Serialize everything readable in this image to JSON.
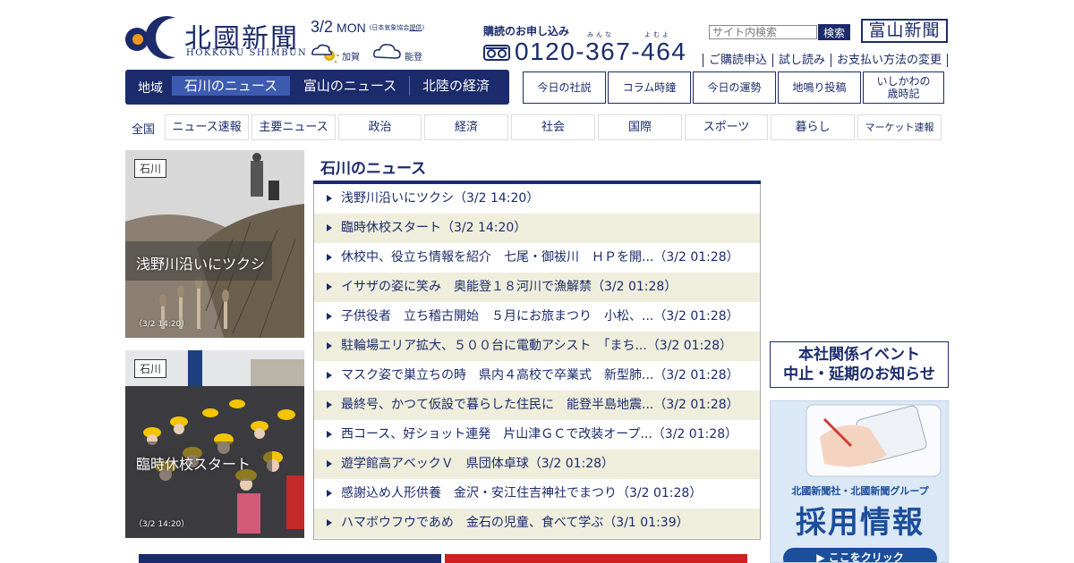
{
  "header": {
    "logo_ja": "北國新聞",
    "logo_en": "HOKKOKU SHIMBUN",
    "date": "3/2",
    "weekday": "MON",
    "weather_source_prefix": "(日本気象協会",
    "weather_source_link": "提供",
    "weather_source_suffix": ")",
    "weather": [
      {
        "area": "加賀",
        "icon": "sun-cloud-icon"
      },
      {
        "area": "能登",
        "icon": "cloud-icon"
      }
    ],
    "subscribe_title": "購読のお申し込み",
    "phone_ruby_1": "みんな",
    "phone_ruby_2": "よむよ",
    "phone": "0120-367-464",
    "search_placeholder": "サイト内検索",
    "search_button": "検索",
    "toyama_logo": "富山新聞",
    "sublinks": [
      "ご購読申込",
      "試し読み",
      "お支払い方法の変更"
    ]
  },
  "region_nav": {
    "label": "地域",
    "tabs": [
      "石川のニュース",
      "富山のニュース",
      "北陸の経済"
    ],
    "active": "石川のニュース"
  },
  "column_buttons": [
    "今日の社説",
    "コラム時鐘",
    "今日の運勢",
    "地鳴り投稿",
    "いしかわの\n歳時記"
  ],
  "categories": {
    "all": "全国",
    "items": [
      "ニュース速報",
      "主要ニュース",
      "政治",
      "経済",
      "社会",
      "国際",
      "スポーツ",
      "暮らし",
      "マーケット速報"
    ]
  },
  "photos": [
    {
      "tag": "石川",
      "caption": "浅野川沿いにツクシ",
      "time": "（3/2 14:20）"
    },
    {
      "tag": "石川",
      "caption": "臨時休校スタート",
      "time": "（3/2 14:20）"
    }
  ],
  "news": {
    "heading": "石川のニュース",
    "items": [
      "浅野川沿いにツクシ（3/2 14:20）",
      "臨時休校スタート（3/2 14:20）",
      "休校中、役立ち情報を紹介　七尾・御祓川　ＨＰを開...（3/2 01:28）",
      "イサザの姿に笑み　奥能登１８河川で漁解禁（3/2 01:28）",
      "子供役者　立ち稽古開始　５月にお旅まつり　小松、...（3/2 01:28）",
      "駐輪場エリア拡大、５００台に電動アシスト　「まち...（3/2 01:28）",
      "マスク姿で巣立ちの時　県内４高校で卒業式　新型肺...（3/2 01:28）",
      "最終号、かつて仮設で暮らした住民に　能登半島地震...（3/2 01:28）",
      "西コース、好ショット連発　片山津ＧＣで改装オープ...（3/2 01:28）",
      "遊学館高アベックＶ　県団体卓球（3/2 01:28）",
      "感謝込め人形供養　金沢・安江住吉神社でまつり（3/2 01:28）",
      "ハマボウフウであめ　金石の児童、食べて学ぶ（3/1 01:39）"
    ]
  },
  "side": {
    "event_line1": "本社関係イベント",
    "event_line2": "中止・延期のお知らせ",
    "recruit_group": "北國新聞社・北國新聞グループ",
    "recruit_title": "採用情報",
    "recruit_button": "▶ ここをクリック"
  },
  "colors": {
    "navy": "#1b2b6b",
    "active_tab": "#3d5bb0",
    "alt_row": "#efeedd",
    "logo_orange": "#f29a1c"
  }
}
